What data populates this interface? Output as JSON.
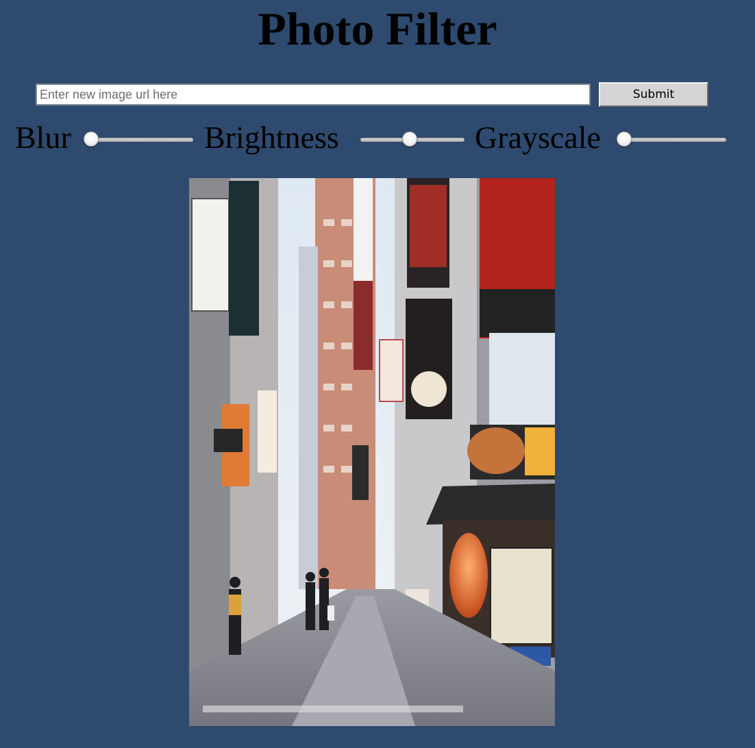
{
  "title": "Photo Filter",
  "url_input": {
    "value": "",
    "placeholder": "Enter new image url here"
  },
  "submit_label": "Submit",
  "sliders": [
    {
      "label": "Blur",
      "value": 0
    },
    {
      "label": "Brightness",
      "value": 0.5
    },
    {
      "label": "Grayscale",
      "value": 0
    }
  ],
  "image": {
    "subject": "street-scene-photo"
  },
  "colors": {
    "background": "#2e4a6e"
  }
}
